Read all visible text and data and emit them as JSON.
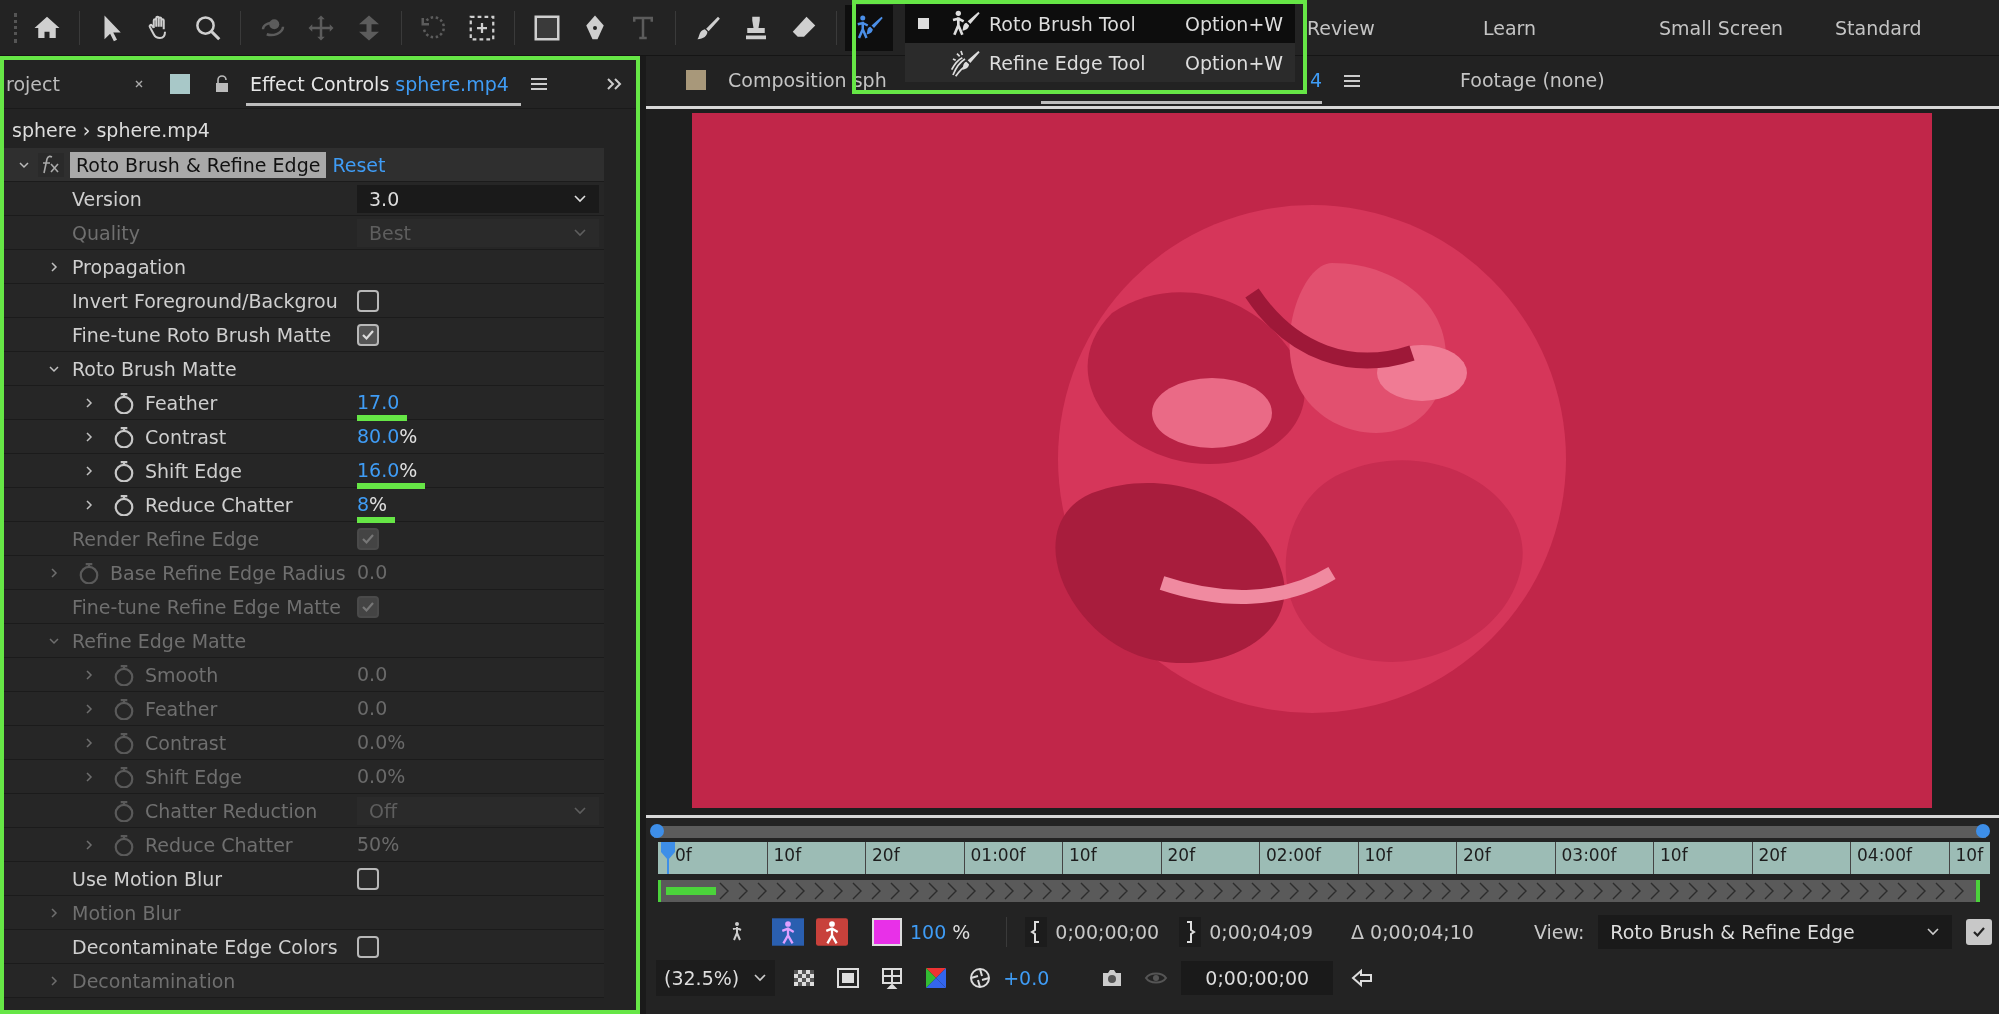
{
  "toolbar": {
    "groups": [
      [
        {
          "kind": "home",
          "disabled": false,
          "selected": false
        }
      ],
      [
        {
          "kind": "select",
          "disabled": false,
          "selected": false
        },
        {
          "kind": "hand",
          "disabled": false,
          "selected": false
        },
        {
          "kind": "zoom",
          "disabled": false,
          "selected": false
        }
      ],
      [
        {
          "kind": "orbit",
          "disabled": true,
          "selected": false
        },
        {
          "kind": "move",
          "disabled": true,
          "selected": false
        },
        {
          "kind": "axis",
          "disabled": true,
          "selected": false
        }
      ],
      [
        {
          "kind": "rotate",
          "disabled": true,
          "selected": false
        },
        {
          "kind": "region",
          "disabled": false,
          "selected": false
        }
      ],
      [
        {
          "kind": "rect",
          "disabled": false,
          "selected": false
        },
        {
          "kind": "pen",
          "disabled": false,
          "selected": false
        },
        {
          "kind": "type",
          "disabled": true,
          "selected": false
        }
      ],
      [
        {
          "kind": "brush",
          "disabled": false,
          "selected": false
        },
        {
          "kind": "stamp",
          "disabled": false,
          "selected": false
        },
        {
          "kind": "eraser",
          "disabled": false,
          "selected": false
        }
      ],
      [
        {
          "kind": "roto",
          "disabled": false,
          "selected": true
        }
      ]
    ],
    "workspaces": [
      "Review",
      "Learn",
      "Small Screen",
      "Standard"
    ]
  },
  "popup_menu": {
    "highlighted": true,
    "items": [
      {
        "kind": "roto",
        "label": "Roto Brush Tool",
        "shortcut": "Option+W",
        "selected": true
      },
      {
        "kind": "refine",
        "label": "Refine Edge Tool",
        "shortcut": "Option+W",
        "selected": false
      }
    ]
  },
  "effect_panel": {
    "highlighted": true,
    "project_tab": "roject",
    "tab_title": "Effect Controls",
    "clip": "sphere.mp4",
    "breadcrumb": "sphere › sphere.mp4",
    "effect": {
      "name": "Roto Brush & Refine Edge",
      "reset": "Reset",
      "expanded": true
    },
    "properties": [
      {
        "kind": "dropdown",
        "label": "Version",
        "value": "3.0",
        "disabled": false,
        "stopwatch": false
      },
      {
        "kind": "dropdown",
        "label": "Quality",
        "value": "Best",
        "disabled": true,
        "stopwatch": false
      },
      {
        "kind": "group",
        "label": "Propagation",
        "disabled": false,
        "expanded": false
      },
      {
        "kind": "checkbox",
        "label": "Invert Foreground/Backgrou",
        "disabled": false,
        "checked": false
      },
      {
        "kind": "checkbox",
        "label": "Fine-tune Roto Brush Matte",
        "disabled": false,
        "checked": true
      },
      {
        "kind": "group",
        "label": "Roto Brush Matte",
        "disabled": false,
        "expanded": true,
        "children": [
          {
            "kind": "number",
            "label": "Feather",
            "value": "17.0",
            "disabled": false,
            "highlighted": true
          },
          {
            "kind": "number",
            "label": "Contrast",
            "value": "80.0",
            "unit": "%",
            "disabled": false,
            "highlighted": false
          },
          {
            "kind": "number",
            "label": "Shift Edge",
            "value": "16.0",
            "unit": "%",
            "disabled": false,
            "highlighted": true
          },
          {
            "kind": "number",
            "label": "Reduce Chatter",
            "value": "8",
            "unit": "%",
            "disabled": false,
            "highlighted": true
          }
        ]
      },
      {
        "kind": "checkbox",
        "label": "Render Refine Edge",
        "disabled": true,
        "checked": true
      },
      {
        "kind": "number",
        "label": "Base Refine Edge Radius",
        "value": "0.0",
        "disabled": true,
        "highlighted": false
      },
      {
        "kind": "checkbox",
        "label": "Fine-tune Refine Edge Matte",
        "disabled": true,
        "checked": true
      },
      {
        "kind": "group",
        "label": "Refine Edge Matte",
        "disabled": true,
        "expanded": true,
        "children": [
          {
            "kind": "number",
            "label": "Smooth",
            "value": "0.0",
            "disabled": true,
            "highlighted": false
          },
          {
            "kind": "number",
            "label": "Feather",
            "value": "0.0",
            "disabled": true,
            "highlighted": false
          },
          {
            "kind": "number",
            "label": "Contrast",
            "value": "0.0%",
            "disabled": true,
            "highlighted": false
          },
          {
            "kind": "number",
            "label": "Shift Edge",
            "value": "0.0%",
            "disabled": true,
            "highlighted": false
          },
          {
            "kind": "dropdown",
            "label": "Chatter Reduction",
            "value": "Off",
            "disabled": true,
            "stopwatch": true
          },
          {
            "kind": "number",
            "label": "Reduce Chatter",
            "value": "50%",
            "disabled": true,
            "highlighted": false
          }
        ]
      },
      {
        "kind": "checkbox",
        "label": "Use Motion Blur",
        "disabled": false,
        "checked": false
      },
      {
        "kind": "group",
        "label": "Motion Blur",
        "disabled": true,
        "expanded": false
      },
      {
        "kind": "checkbox",
        "label": "Decontaminate Edge Colors",
        "disabled": false,
        "checked": false
      },
      {
        "kind": "group",
        "label": "Decontamination",
        "disabled": true,
        "expanded": false
      }
    ]
  },
  "composition_panel": {
    "tabs": [
      {
        "kind": "composition",
        "label": "Composition sph",
        "tail": "4",
        "selected": true
      },
      {
        "kind": "footage",
        "label": "Footage (none)",
        "selected": false
      }
    ],
    "timeline": {
      "ruler_labels": [
        "0f",
        "10f",
        "20f",
        "01:00f",
        "10f",
        "20f",
        "02:00f",
        "10f",
        "20f",
        "03:00f",
        "10f",
        "20f",
        "04:00f",
        "10f"
      ],
      "color": "#e830e8",
      "zoom_value": "100",
      "zoom_unit": "%",
      "in_point": "0;00;00;00",
      "out_point": "0;00;04;09",
      "duration": "Δ 0;00;04;10",
      "view_label": "View:",
      "view_value": "Roto Brush & Refine Edge",
      "view_checked": true
    },
    "footer": {
      "magnification": "(32.5%)",
      "exposure": "+0.0",
      "timecode": "0;00;00;00"
    }
  }
}
